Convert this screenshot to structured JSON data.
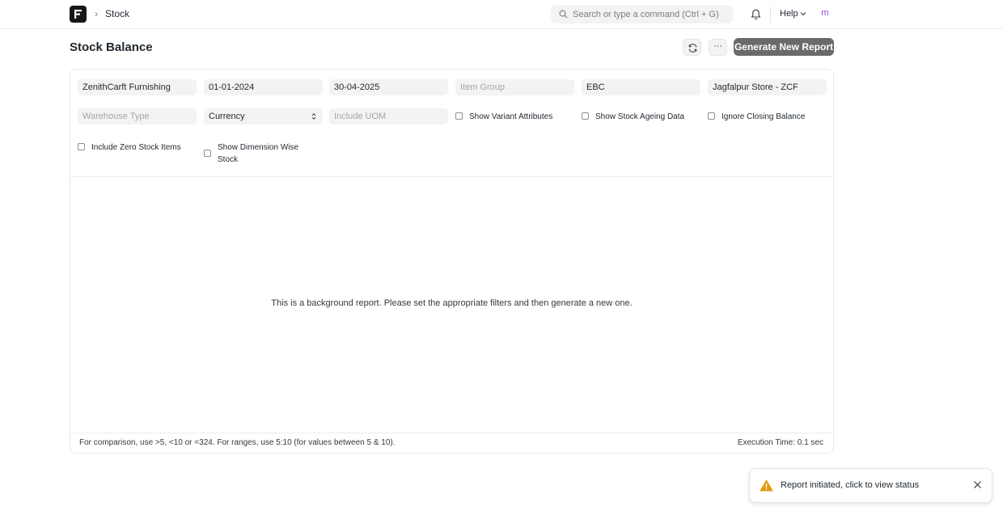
{
  "navbar": {
    "breadcrumb_sep": "›",
    "breadcrumb": "Stock",
    "search_placeholder": "Search or type a command (Ctrl + G)",
    "help_label": "Help",
    "avatar_initial": "m"
  },
  "page": {
    "title": "Stock Balance",
    "more_label": "···",
    "generate_label": "Generate New Report"
  },
  "filters": {
    "company": "ZenithCarft Furnishing",
    "from_date": "01-01-2024",
    "to_date": "30-04-2025",
    "item_group_placeholder": "Item Group",
    "item": "EBC",
    "warehouse": "Jagfalpur Store - ZCF",
    "warehouse_type_placeholder": "Warehouse Type",
    "currency": "Currency",
    "include_uom_placeholder": "Include UOM",
    "show_variant_attributes": "Show Variant Attributes",
    "show_stock_ageing_data": "Show Stock Ageing Data",
    "ignore_closing_balance": "Ignore Closing Balance",
    "include_zero_stock_items": "Include Zero Stock Items",
    "show_dimension_wise_stock_line1": "Show Dimension Wise",
    "show_dimension_wise_stock_line2": "Stock"
  },
  "report": {
    "empty_message": "This is a background report. Please set the appropriate filters and then generate a new one.",
    "footer_hint": "For comparison, use >5, <10 or =324. For ranges, use 5:10 (for values between 5 & 10).",
    "execution_time": "Execution Time: 0.1 sec"
  },
  "toast": {
    "message": "Report initiated, click to view status"
  },
  "colors": {
    "primary_button": "#6a6a6a",
    "avatar_text": "#9c45e3",
    "warning_icon": "#e79913"
  }
}
